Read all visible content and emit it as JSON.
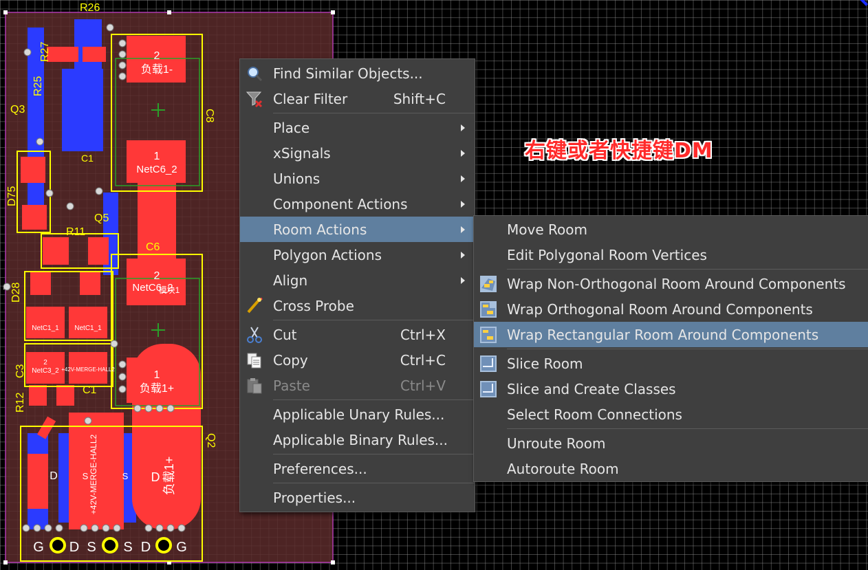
{
  "annotation": "右键或者快捷键DM",
  "pcb": {
    "designators": [
      "R26",
      "R27",
      "R25",
      "Q3",
      "C1",
      "D75",
      "R11",
      "Q5",
      "C6",
      "C8",
      "D28",
      "C3",
      "R12",
      "C1",
      "Q2"
    ],
    "pads": [
      "2",
      "负载1-",
      "1",
      "NetC6_2",
      "2",
      "NetC6_2",
      "模块1",
      "1",
      "负载1+",
      "D",
      "负载1+",
      "S",
      "+42V-MERGE-HALL2",
      "S",
      "D",
      "NetC1_1",
      "NetC1_1",
      "2",
      "NetC3_2",
      "+42V-MERGE-HALL2"
    ],
    "pin_labels": [
      "G",
      "D",
      "S",
      "S",
      "D",
      "G"
    ]
  },
  "context_menu": {
    "items": [
      {
        "label": "Find Similar Objects...",
        "icon": "magnifier-icon"
      },
      {
        "label": "Clear Filter",
        "shortcut": "Shift+C",
        "icon": "clear-filter-icon"
      },
      {
        "label": "Place",
        "submenu": true
      },
      {
        "label": "xSignals",
        "submenu": true
      },
      {
        "label": "Unions",
        "submenu": true
      },
      {
        "label": "Component Actions",
        "submenu": true
      },
      {
        "label": "Room Actions",
        "submenu": true,
        "highlighted": true
      },
      {
        "label": "Polygon Actions",
        "submenu": true
      },
      {
        "label": "Align",
        "submenu": true
      },
      {
        "label": "Cross Probe",
        "icon": "cross-probe-icon"
      },
      {
        "label": "Cut",
        "shortcut": "Ctrl+X",
        "icon": "scissors-icon"
      },
      {
        "label": "Copy",
        "shortcut": "Ctrl+C",
        "icon": "copy-icon"
      },
      {
        "label": "Paste",
        "shortcut": "Ctrl+V",
        "icon": "paste-icon",
        "disabled": true
      },
      {
        "label": "Applicable Unary Rules..."
      },
      {
        "label": "Applicable Binary Rules..."
      },
      {
        "label": "Preferences..."
      },
      {
        "label": "Properties..."
      }
    ]
  },
  "room_actions_submenu": {
    "items": [
      {
        "label": "Move Room"
      },
      {
        "label": "Edit Polygonal Room Vertices"
      },
      {
        "label": "Wrap Non-Orthogonal Room Around Components",
        "icon": "wrap-non-orthogonal-icon"
      },
      {
        "label": "Wrap Orthogonal Room Around Components",
        "icon": "wrap-orthogonal-icon"
      },
      {
        "label": "Wrap Rectangular Room Around Components",
        "icon": "wrap-rectangular-icon",
        "highlighted": true
      },
      {
        "label": "Slice Room",
        "icon": "slice-room-icon"
      },
      {
        "label": "Slice and Create Classes",
        "icon": "slice-classes-icon"
      },
      {
        "label": "Select Room Connections"
      },
      {
        "label": "Unroute Room"
      },
      {
        "label": "Autoroute Room"
      }
    ]
  },
  "colors": {
    "top_copper": "#ff3838",
    "bottom_copper": "#2b3bff",
    "overlay": "#ffff00",
    "highlight": "#5f7f9f",
    "menu_bg": "#3f3f3f"
  }
}
